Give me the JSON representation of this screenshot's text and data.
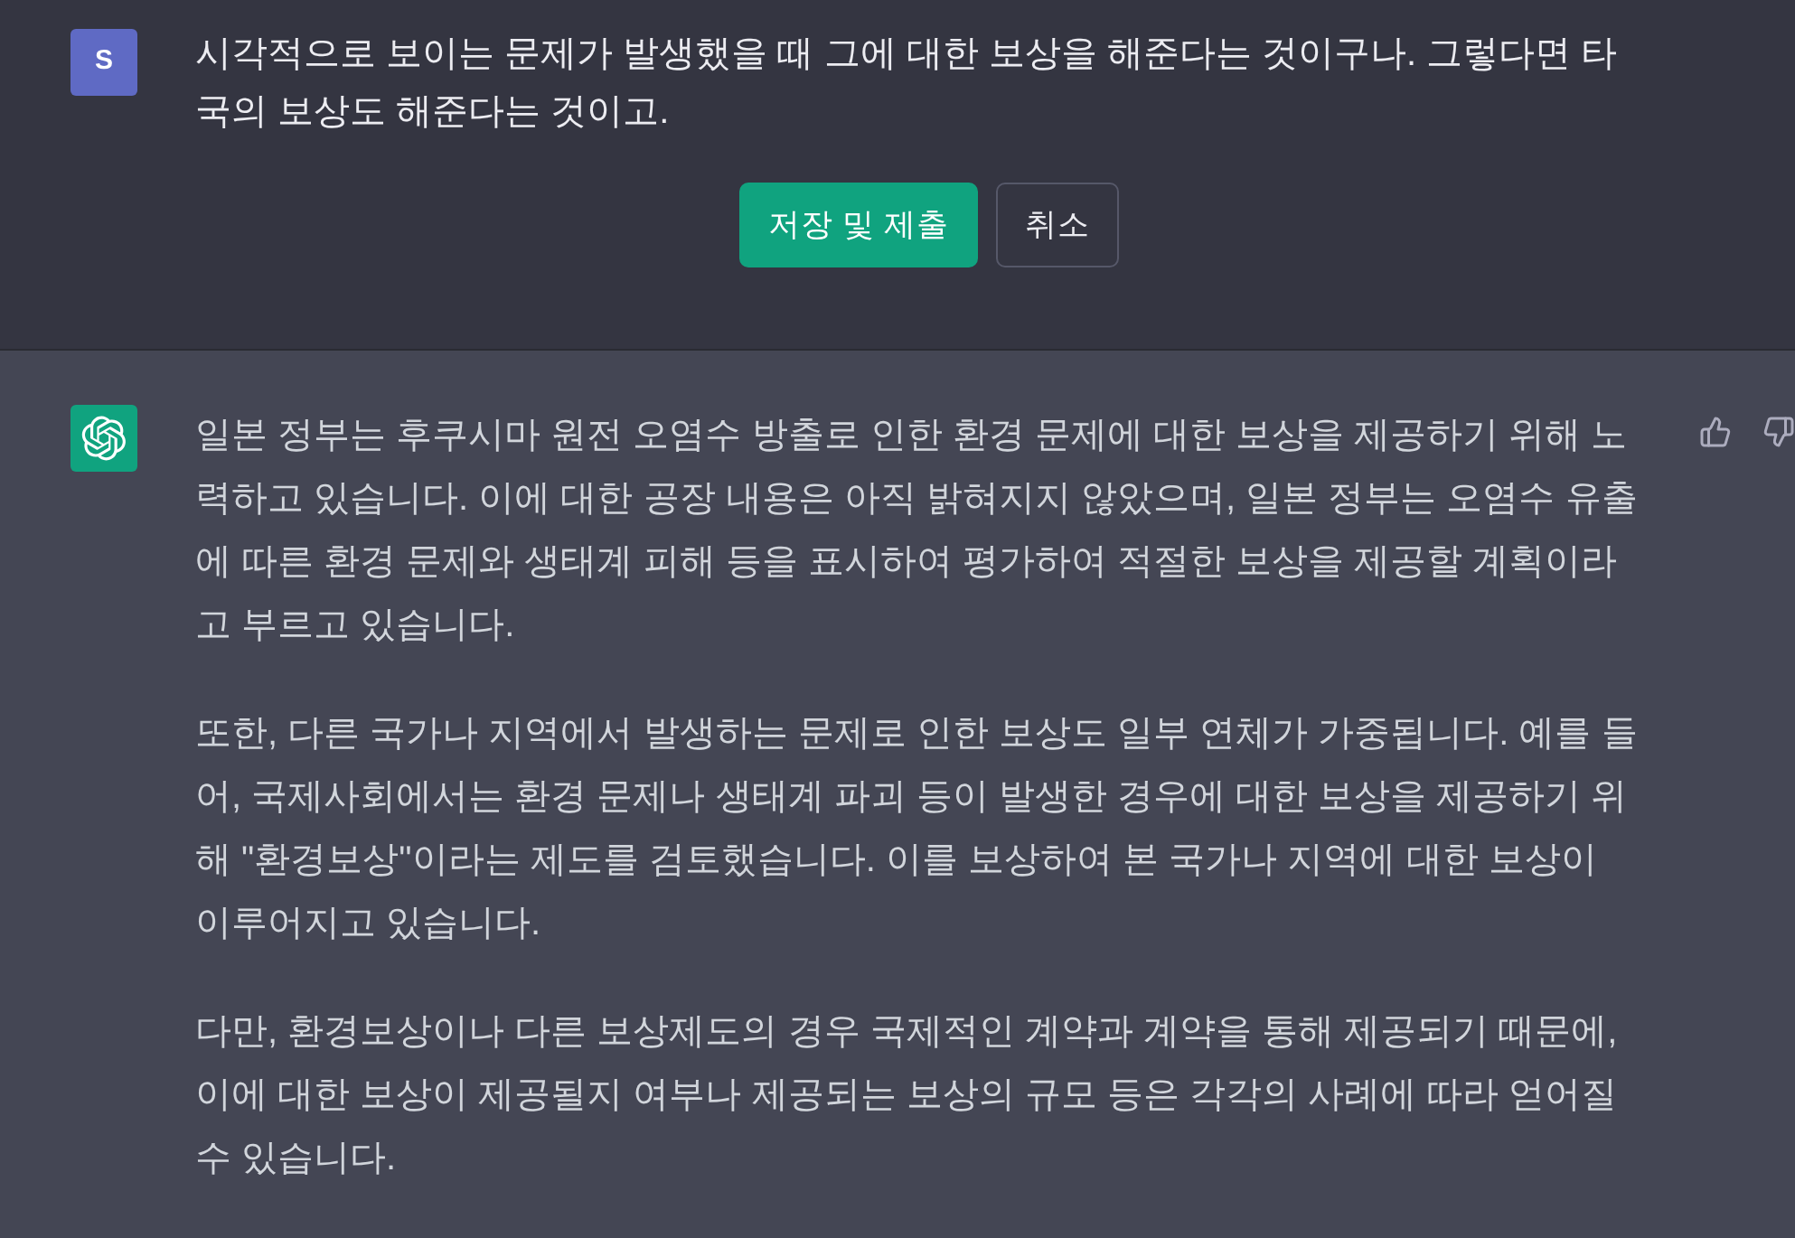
{
  "user_message": {
    "avatar": {
      "initial": "S"
    },
    "text": "시각적으로 보이는 문제가 발생했을 때 그에 대한 보상을 해준다는 것이구나. 그렇다면 타국의 보상도 해준다는 것이고.",
    "actions": [
      {
        "label": "저장 및 제출",
        "kind": "primary"
      },
      {
        "label": "취소",
        "kind": "secondary"
      }
    ]
  },
  "assistant_message": {
    "paragraphs": [
      "일본 정부는 후쿠시마 원전 오염수 방출로 인한 환경 문제에 대한 보상을 제공하기 위해 노력하고 있습니다. 이에 대한 공장 내용은 아직 밝혀지지 않았으며, 일본 정부는 오염수 유출에 따른 환경 문제와 생태계 피해 등을 표시하여 평가하여 적절한 보상을 제공할 계획이라고 부르고 있습니다.",
      "또한, 다른 국가나 지역에서 발생하는 문제로 인한 보상도 일부 연체가 가중됩니다. 예를 들어, 국제사회에서는 환경 문제나 생태계 파괴 등이 발생한 경우에 대한 보상을 제공하기 위해 \"환경보상\"이라는 제도를 검토했습니다. 이를 보상하여 본 국가나 지역에 대한 보상이 이루어지고 있습니다.",
      "다만, 환경보상이나 다른 보상제도의 경우 국제적인 계약과 계약을 통해 제공되기 때문에, 이에 대한 보상이 제공될지 여부나 제공되는 보상의 규모 등은 각각의 사례에 따라 얻어질 수 있습니다."
    ]
  }
}
